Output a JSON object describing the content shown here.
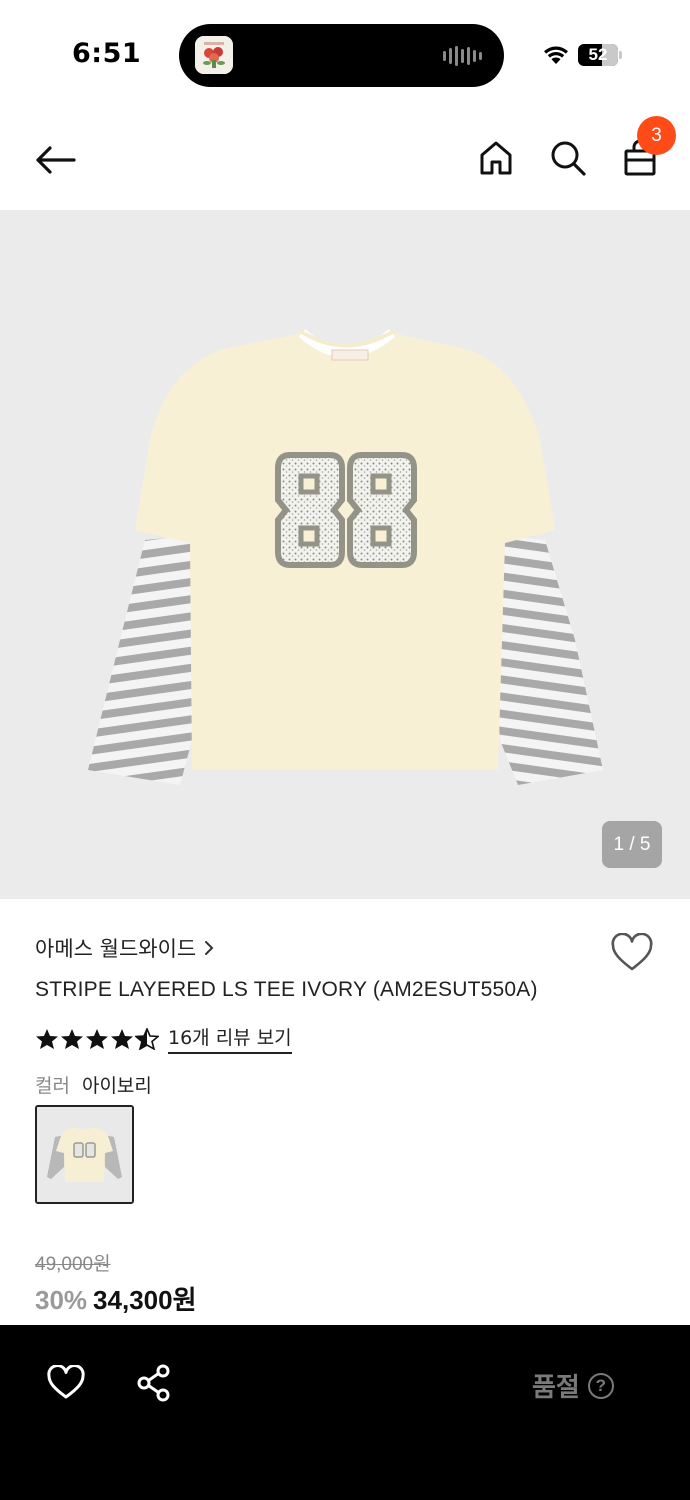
{
  "status_bar": {
    "time": "6:51",
    "battery_level": "52",
    "icons": [
      "app-thumbnail-icon",
      "audio-wave-icon",
      "wifi-icon",
      "battery-icon"
    ]
  },
  "header": {
    "icons": [
      "back-arrow-icon",
      "home-icon",
      "search-icon",
      "shopping-bag-icon"
    ],
    "cart_count": "3",
    "badge_color": "#ff4b17"
  },
  "gallery": {
    "page_indicator": "1 / 5",
    "current": 1,
    "total": 5
  },
  "product": {
    "brand": "아메스 월드와이드",
    "title": "STRIPE LAYERED LS TEE IVORY (AM2ESUT550A)",
    "rating": 4.5,
    "rating_max": 5,
    "reviews_link": "16개 리뷰 보기",
    "color_label": "컬러",
    "color_value": "아이보리",
    "original_price": "49,000원",
    "discount": "30%",
    "price": "34,300원"
  },
  "bottom_bar": {
    "status_label": "품절",
    "help_symbol": "?",
    "icons": [
      "heart-icon",
      "share-icon",
      "help-circle-icon"
    ]
  }
}
